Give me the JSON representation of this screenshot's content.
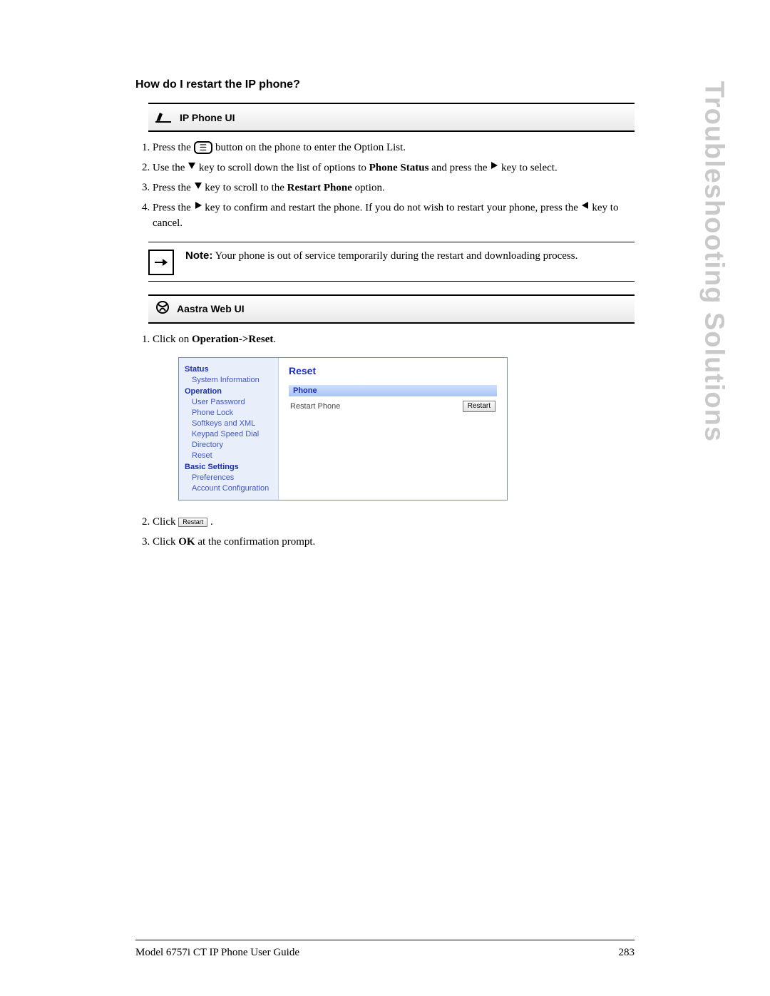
{
  "tab_title": "Troubleshooting Solutions",
  "heading": "How do I restart the IP phone?",
  "section_ipphone": "IP Phone UI",
  "section_web": "Aastra Web UI",
  "steps_phone": {
    "s1_a": "Press the ",
    "s1_b": " button on the phone to enter the Option List.",
    "s2_a": "Use the ",
    "s2_b": " key to scroll down the list of options to ",
    "s2_bold": "Phone Status",
    "s2_c": " and press the ",
    "s2_d": " key to select.",
    "s3_a": "Press the ",
    "s3_b": " key to scroll to the ",
    "s3_bold": "Restart Phone",
    "s3_c": " option.",
    "s4_a": "Press the ",
    "s4_b": " key to confirm and restart the phone. If you do not wish to restart your phone, press the ",
    "s4_c": " key to cancel."
  },
  "note": {
    "label": "Note:",
    "text": " Your phone is out of service temporarily during the restart and downloading process."
  },
  "steps_web": {
    "s1_a": "Click on ",
    "s1_bold": "Operation->Reset",
    "s1_c": ".",
    "s2_a": "Click ",
    "s2_btn": "Restart",
    "s2_c": " .",
    "s3_a": "Click ",
    "s3_bold": "OK",
    "s3_c": " at the confirmation prompt."
  },
  "webui": {
    "title": "Reset",
    "subheader": "Phone",
    "row_label": "Restart Phone",
    "row_button": "Restart",
    "sidebar": {
      "groups": [
        {
          "label": "Status",
          "items": [
            "System Information"
          ]
        },
        {
          "label": "Operation",
          "items": [
            "User Password",
            "Phone Lock",
            "Softkeys and XML",
            "Keypad Speed Dial",
            "Directory",
            "Reset"
          ]
        },
        {
          "label": "Basic Settings",
          "items": [
            "Preferences",
            "Account Configuration"
          ]
        }
      ]
    }
  },
  "footer": {
    "left": "Model 6757i CT IP Phone User Guide",
    "right": "283"
  }
}
